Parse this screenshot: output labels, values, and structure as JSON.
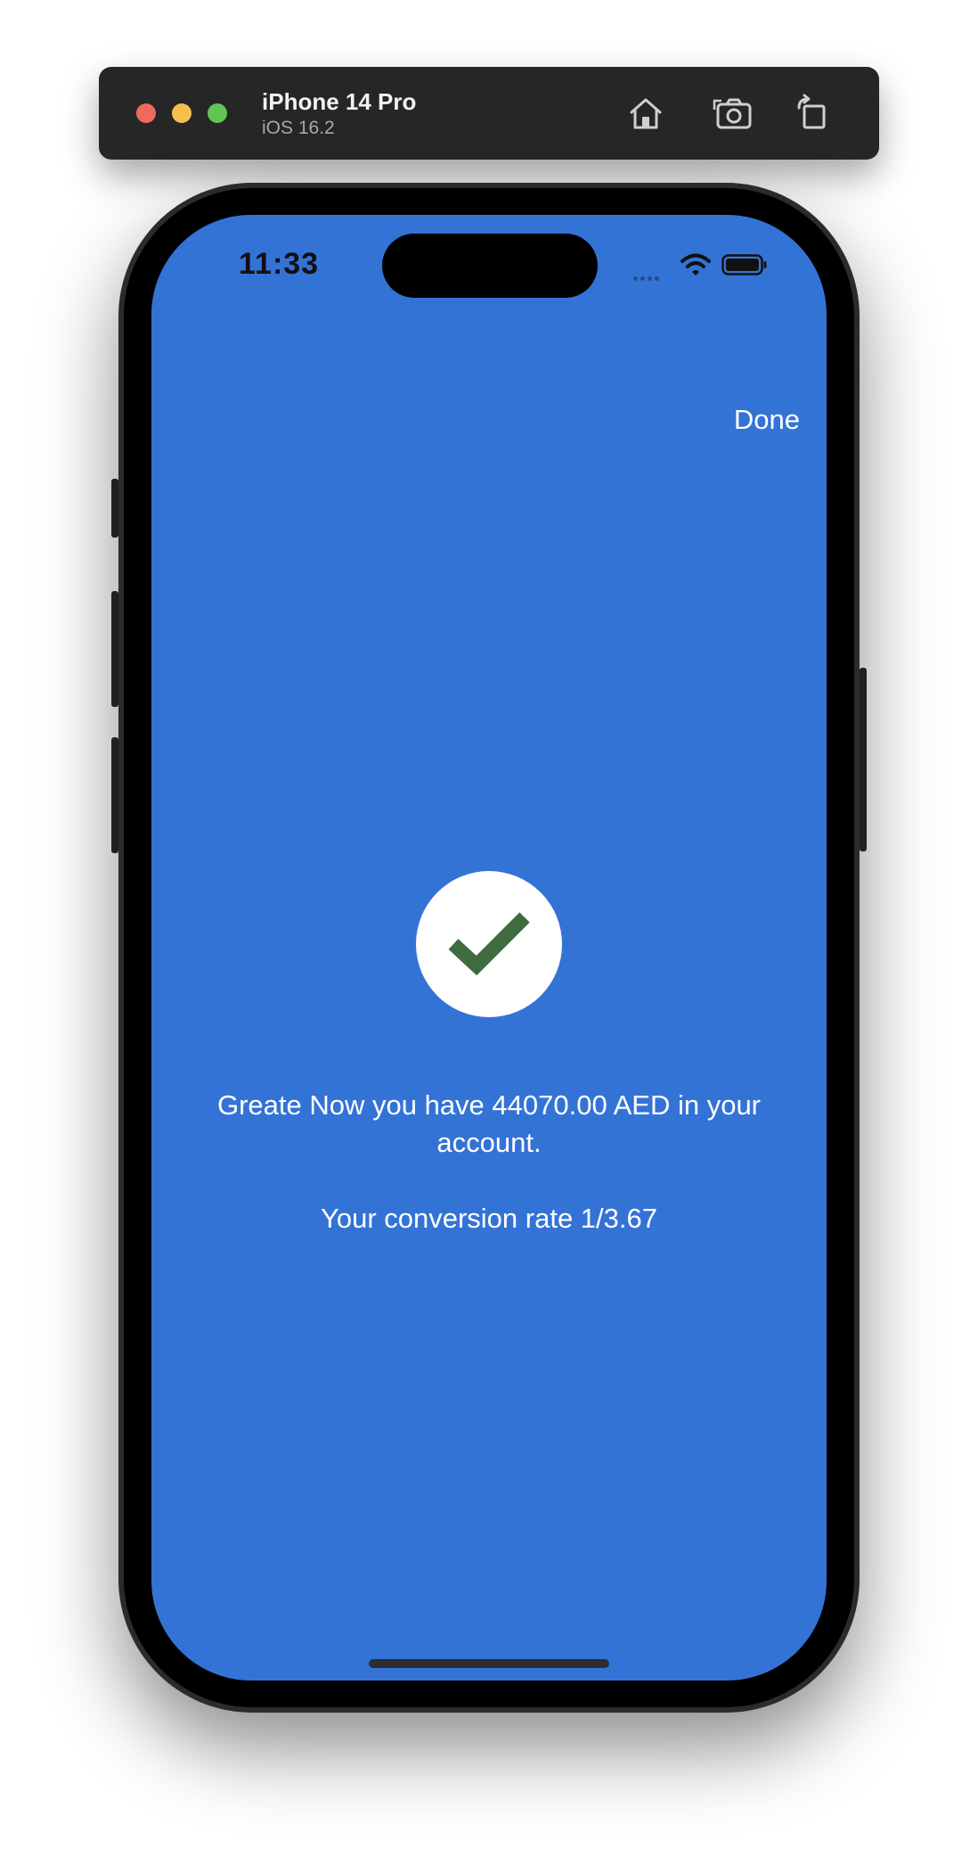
{
  "simulator": {
    "device_name": "iPhone 14 Pro",
    "os_version": "iOS 16.2"
  },
  "status_bar": {
    "time": "11:33"
  },
  "nav": {
    "done_label": "Done"
  },
  "success": {
    "message": "Greate Now you have 44070.00 AED in your account.",
    "conversion_rate": "Your conversion rate 1/3.67"
  },
  "colors": {
    "screen_background": "#3473d6",
    "check_color": "#3e6b3f"
  },
  "icons": {
    "toolbar": [
      "home-icon",
      "screenshot-icon",
      "rotate-icon"
    ],
    "status": [
      "wifi-icon",
      "battery-icon"
    ],
    "success": "checkmark-icon"
  }
}
